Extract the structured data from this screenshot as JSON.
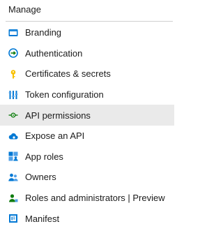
{
  "section": {
    "title": "Manage"
  },
  "menu": {
    "items": [
      {
        "label": "Branding",
        "icon": "branding-icon"
      },
      {
        "label": "Authentication",
        "icon": "authentication-icon"
      },
      {
        "label": "Certificates & secrets",
        "icon": "key-icon"
      },
      {
        "label": "Token configuration",
        "icon": "token-icon"
      },
      {
        "label": "API permissions",
        "icon": "api-permissions-icon",
        "selected": true
      },
      {
        "label": "Expose an API",
        "icon": "cloud-icon"
      },
      {
        "label": "App roles",
        "icon": "app-roles-icon"
      },
      {
        "label": "Owners",
        "icon": "owners-icon"
      },
      {
        "label": "Roles and administrators | Preview",
        "icon": "roles-icon"
      },
      {
        "label": "Manifest",
        "icon": "manifest-icon"
      }
    ]
  },
  "colors": {
    "selected_background": "#eaeaea",
    "text": "#1b1b1b",
    "divider": "#d0d0d0",
    "blue": "#0078d4",
    "green": "#107c10",
    "yellow": "#f8c100"
  }
}
